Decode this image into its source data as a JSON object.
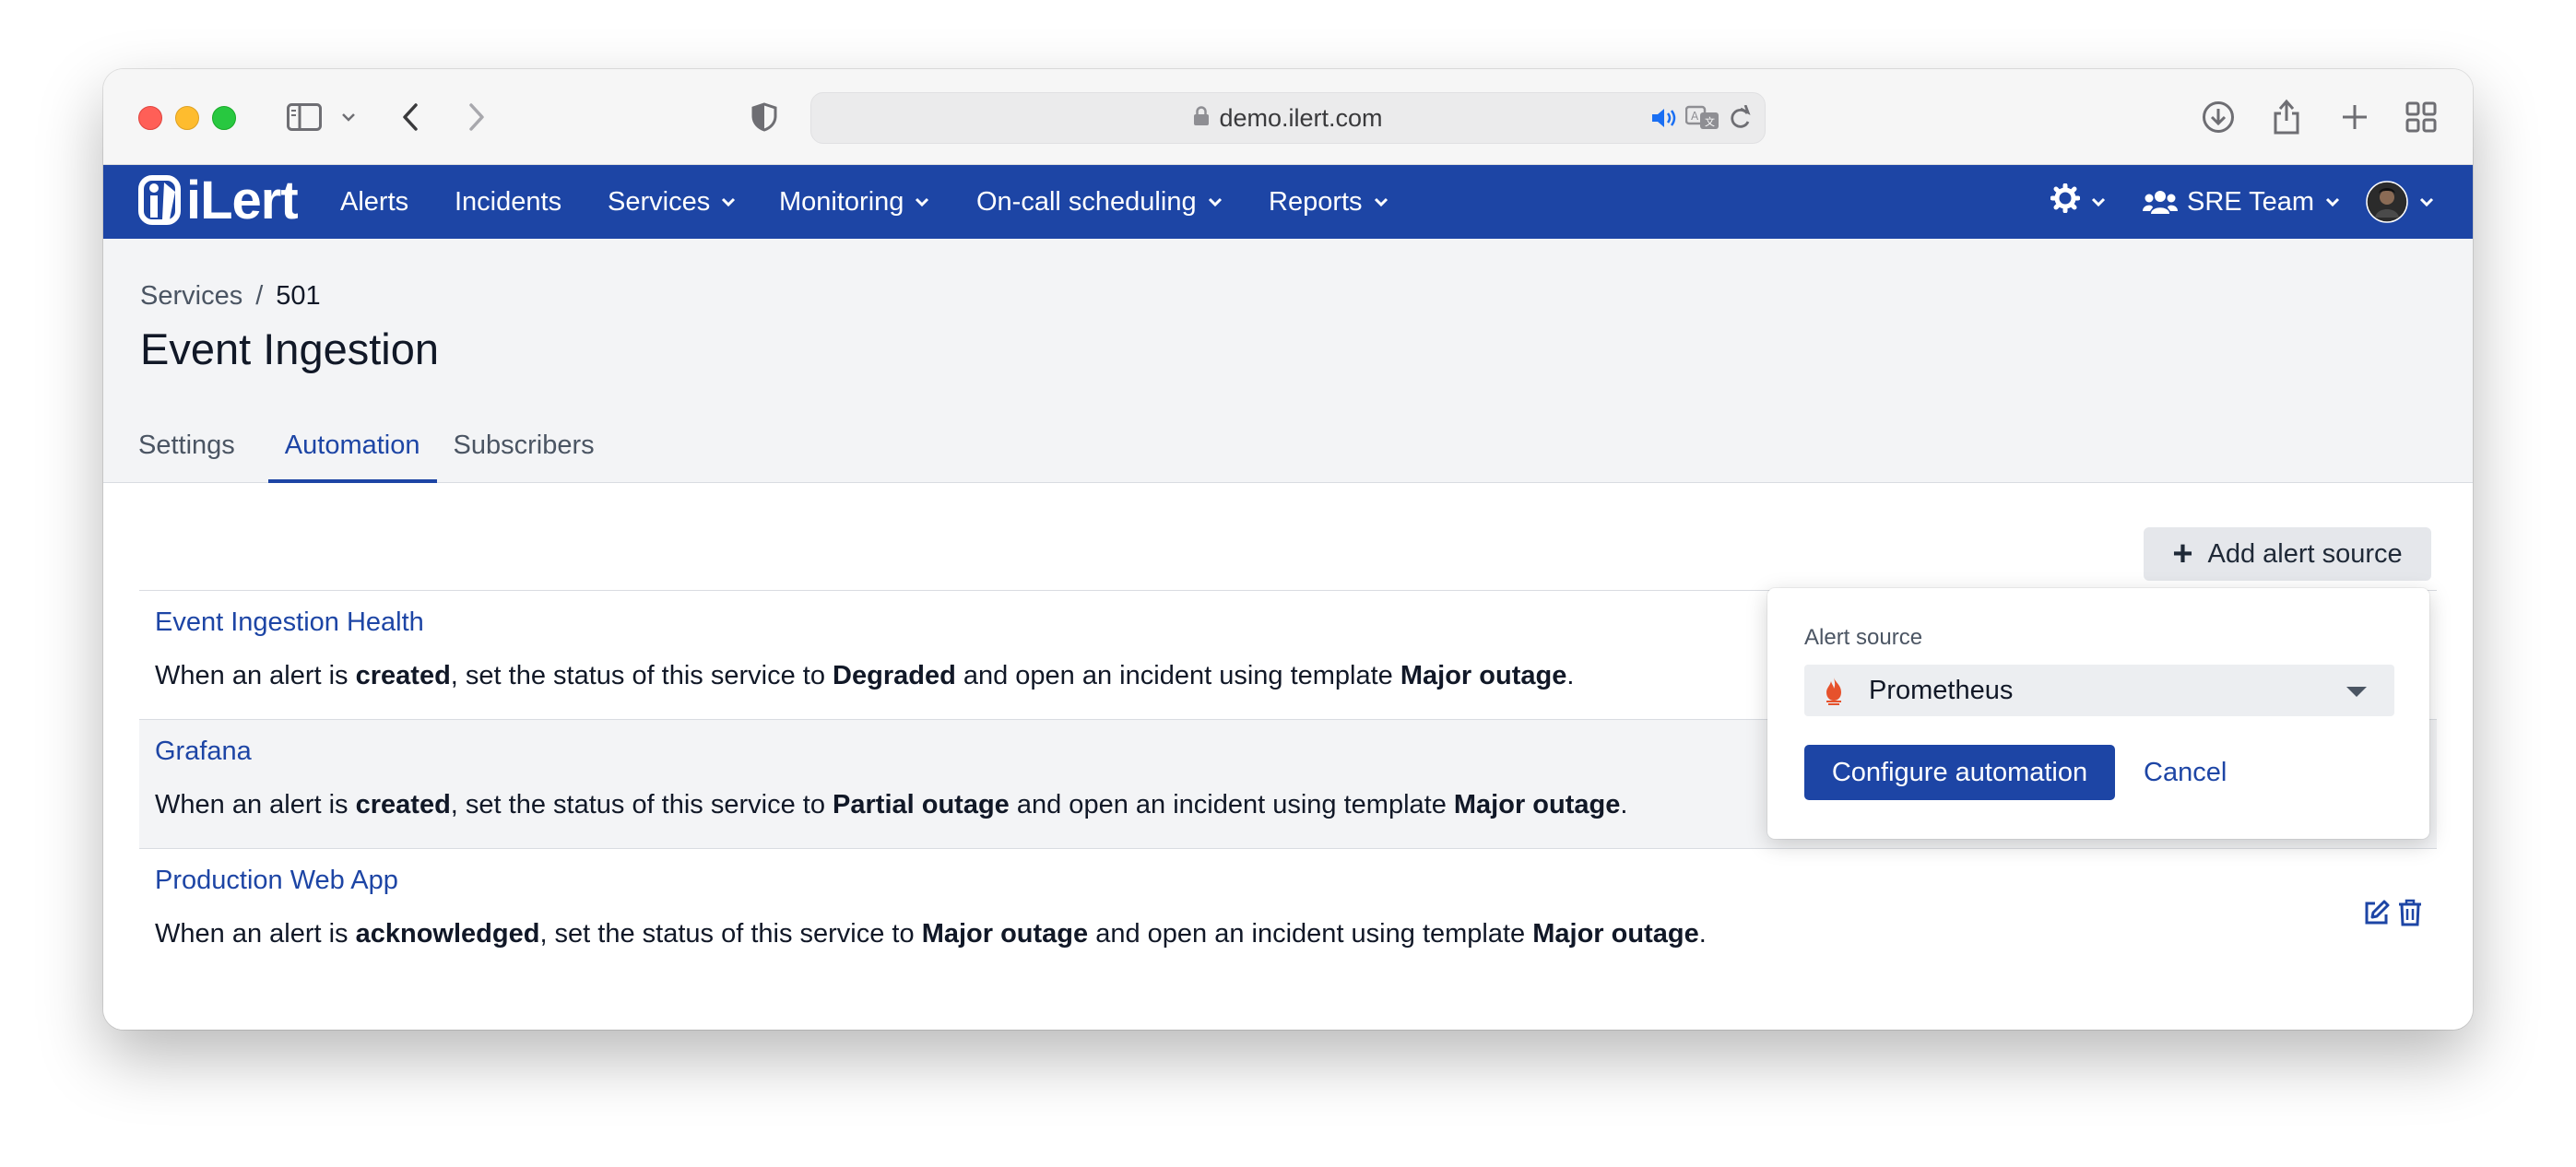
{
  "browser": {
    "url": "demo.ilert.com"
  },
  "nav": {
    "logo": "iLert",
    "items": [
      {
        "label": "Alerts"
      },
      {
        "label": "Incidents"
      },
      {
        "label": "Services"
      },
      {
        "label": "Monitoring"
      },
      {
        "label": "On-call scheduling"
      },
      {
        "label": "Reports"
      }
    ],
    "team": "SRE Team"
  },
  "breadcrumb": {
    "parent": "Services",
    "separator": "/",
    "current": "501"
  },
  "page_title": "Event Ingestion",
  "tabs": [
    {
      "label": "Settings",
      "active": false
    },
    {
      "label": "Automation",
      "active": true
    },
    {
      "label": "Subscribers",
      "active": false
    }
  ],
  "add_button": {
    "label": "Add alert source"
  },
  "sentence": {
    "p1": "When an alert is ",
    "p2": ", set the status of this service to ",
    "p3": " and open an incident using template ",
    "p4": "."
  },
  "automations": [
    {
      "title": "Event Ingestion Health",
      "event": "created",
      "status": "Degraded",
      "template": "Major outage"
    },
    {
      "title": "Grafana",
      "event": "created",
      "status": "Partial outage",
      "template": "Major outage"
    },
    {
      "title": "Production Web App",
      "event": "acknowledged",
      "status": "Major outage",
      "template": "Major outage"
    }
  ],
  "popover": {
    "label": "Alert source",
    "selected": "Prometheus",
    "confirm": "Configure automation",
    "cancel": "Cancel"
  },
  "colors": {
    "brand": "#1d45a5",
    "prometheus": "#e6522c"
  }
}
